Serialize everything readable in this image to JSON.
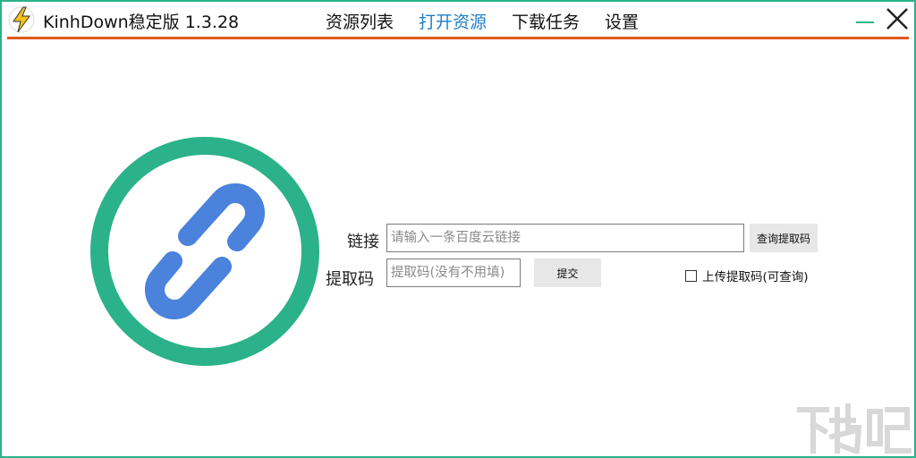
{
  "app": {
    "title": "KinhDown稳定版 1.3.28",
    "logo_icon": "lightning-bolt-icon",
    "accent_color": "#2bb28a",
    "rule_color": "#e05a1c",
    "active_color": "#1e7fc9"
  },
  "nav": {
    "items": [
      {
        "label": "资源列表",
        "active": false
      },
      {
        "label": "打开资源",
        "active": true
      },
      {
        "label": "下载任务",
        "active": false
      },
      {
        "label": "设置",
        "active": false
      }
    ]
  },
  "window_controls": {
    "minimize_icon": "minimize-icon",
    "close_icon": "close-icon"
  },
  "graphic": {
    "icon": "chain-link-icon",
    "ring_color": "#2bb28a",
    "link_color": "#4a82dc"
  },
  "form": {
    "link_label": "链接",
    "link_value": "",
    "link_placeholder": "请输入一条百度云链接",
    "query_button": "查询提取码",
    "code_label": "提取码",
    "code_value": "",
    "code_placeholder": "提取码(没有不用填)",
    "submit_button": "提交",
    "upload_checkbox_label": "上传提取码(可查询)",
    "upload_checked": false
  },
  "watermark": {
    "text": "下载吧"
  }
}
